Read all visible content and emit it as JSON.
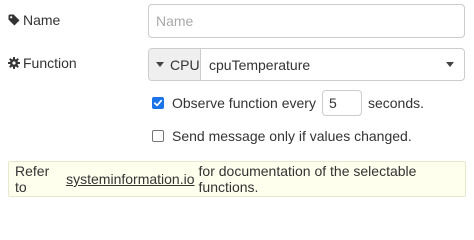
{
  "name_row": {
    "label": "Name",
    "icon": "tag-icon",
    "placeholder": "Name",
    "value": ""
  },
  "function_row": {
    "label": "Function",
    "icon": "gear-icon",
    "type_label": "CPU",
    "selected_value": "cpuTemperature"
  },
  "observe": {
    "checked": true,
    "label_before": "Observe function every",
    "interval_value": "5",
    "label_after": "seconds."
  },
  "send_changed": {
    "checked": false,
    "label": "Send message only if values changed."
  },
  "tip": {
    "prefix": "Refer to",
    "link_text": "systeminformation.io",
    "suffix": "for documentation of the selectable functions."
  },
  "colors": {
    "checkbox_accent": "#1a73e8",
    "tip_background": "#ffffee",
    "border": "#cccccc"
  }
}
